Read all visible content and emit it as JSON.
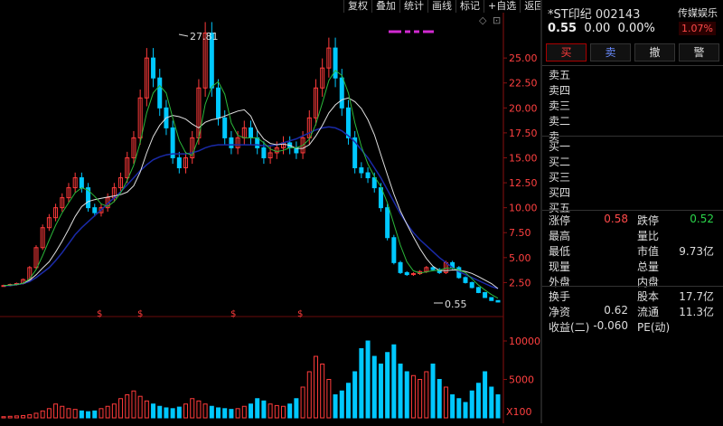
{
  "toolbar": {
    "items": [
      "复权",
      "叠加",
      "统计",
      "画线",
      "标记",
      "+自选",
      "返回"
    ]
  },
  "stock": {
    "name_code": "*ST印纪 002143",
    "price": "0.55",
    "change": "0.00",
    "change_pct": "0.00%",
    "sector": "传媒娱乐",
    "sector_pct": "1.07%"
  },
  "trade_buttons": [
    "买",
    "卖",
    "撤",
    "警"
  ],
  "order_book": {
    "asks": [
      "卖五",
      "卖四",
      "卖三",
      "卖二",
      "卖一"
    ],
    "bids": [
      "买一",
      "买二",
      "买三",
      "买四",
      "买五"
    ]
  },
  "stats": {
    "zhangting_label": "涨停",
    "zhangting_val": "0.58",
    "dieting_label": "跌停",
    "dieting_val": "0.52",
    "zuigao_label": "最高",
    "liangbi_label": "量比",
    "zuidi_label": "最低",
    "shizhi_label": "市值",
    "shizhi_val": "9.73亿",
    "xianliang_label": "现量",
    "zongliang_label": "总量",
    "waipan_label": "外盘",
    "neipan_label": "内盘",
    "huanshou_label": "换手",
    "guben_label": "股本",
    "guben_val": "17.7亿",
    "jingzi_label": "净资",
    "jingzi_val": "0.62",
    "liutong_label": "流通",
    "liutong_val": "11.3亿",
    "shouyi_label": "收益(二)",
    "shouyi_val": "-0.060",
    "pe_label": "PE(动)"
  },
  "colors": {
    "up": "#ff3b3b",
    "down": "#00c8ff",
    "axis": "#ff4040",
    "ma_blue": "#1a2aa8"
  },
  "chart_data": {
    "type": "line",
    "price_axis": {
      "ticks": [
        "25.00",
        "22.50",
        "20.00",
        "17.50",
        "15.00",
        "12.50",
        "10.00",
        "7.50",
        "5.00",
        "2.50"
      ],
      "ylim": [
        0,
        29
      ]
    },
    "volume_axis": {
      "ticks": [
        "10000",
        "5000"
      ],
      "unit_label": "X100",
      "ylim": [
        0,
        12000
      ]
    },
    "annotations": {
      "high": "27.81",
      "last": "0.55"
    },
    "markers": [
      "$",
      "$",
      "$",
      "$"
    ],
    "price_close": [
      2.2,
      2.3,
      2.4,
      2.8,
      4,
      6,
      8,
      9,
      10,
      11,
      12,
      13,
      12,
      10,
      9.5,
      10,
      11,
      12,
      13,
      15,
      17,
      21,
      25,
      23,
      20,
      18,
      15,
      14,
      15,
      17,
      22,
      27.5,
      22,
      19,
      17,
      16,
      17,
      18,
      17,
      16,
      15,
      15.5,
      16,
      16.5,
      16,
      15.5,
      17,
      19,
      22,
      24,
      26,
      23,
      20,
      17,
      14,
      13.5,
      13,
      12,
      10,
      7,
      4.5,
      3.5,
      3.3,
      3.4,
      3.6,
      4,
      3.8,
      3.5,
      4.5,
      4,
      3,
      2.5,
      2,
      1.5,
      1,
      0.7,
      0.55
    ],
    "ma_blue": [
      2.2,
      2.2,
      2.3,
      2.4,
      2.6,
      3,
      3.5,
      4,
      4.7,
      5.5,
      6.4,
      7.3,
      8,
      8.6,
      9.2,
      9.8,
      10.4,
      11,
      11.6,
      12.3,
      13,
      13.7,
      14.3,
      14.8,
      15.1,
      15.3,
      15.4,
      15.4,
      15.4,
      15.5,
      15.7,
      16,
      16.2,
      16.3,
      16.3,
      16.3,
      16.3,
      16.3,
      16.3,
      16.3,
      16.2,
      16.2,
      16.3,
      16.5,
      16.7,
      16.9,
      17.2,
      17.5,
      17.8,
      18,
      18.1,
      18,
      17.7,
      17.2,
      16.6,
      15.8,
      15,
      14,
      13,
      11.8,
      10.6,
      9.4,
      8.4,
      7.5,
      6.8,
      6.2,
      5.6,
      5,
      4.5,
      4,
      3.6,
      3.3,
      3,
      2.7,
      2.4,
      2.1,
      1.9
    ],
    "volume": [
      150,
      200,
      250,
      300,
      400,
      600,
      900,
      1200,
      1800,
      1500,
      1200,
      1100,
      900,
      800,
      900,
      1200,
      1500,
      1800,
      2500,
      3000,
      3500,
      2800,
      2200,
      1800,
      1500,
      1300,
      1200,
      1400,
      1800,
      2500,
      2200,
      1800,
      1500,
      1300,
      1200,
      1100,
      1200,
      1500,
      1800,
      2500,
      2200,
      1800,
      1600,
      1500,
      1800,
      2500,
      4000,
      6000,
      8000,
      7000,
      5000,
      3000,
      3500,
      4500,
      6000,
      9000,
      10000,
      8000,
      7000,
      8500,
      9500,
      7000,
      6000,
      5500,
      5000,
      6000,
      7000,
      5000,
      4000,
      3000,
      2500,
      2000,
      3500,
      4500,
      6000,
      4000,
      3000
    ]
  }
}
